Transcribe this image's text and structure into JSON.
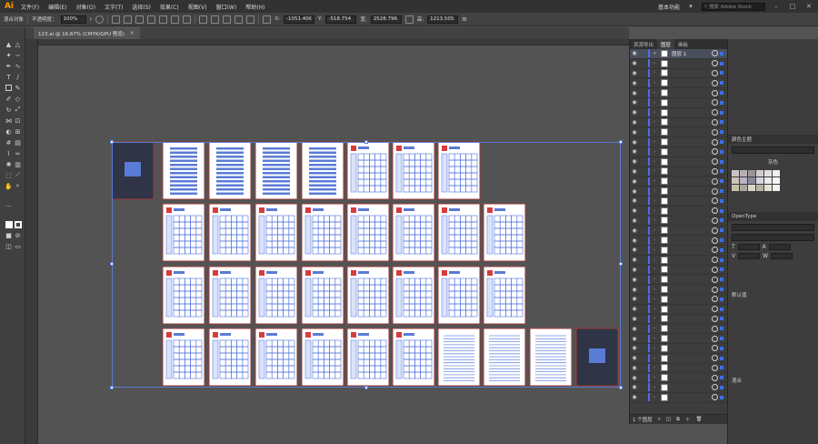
{
  "app": {
    "logo": "Ai"
  },
  "menu": {
    "items": [
      "文件(F)",
      "编辑(E)",
      "对象(O)",
      "文字(T)",
      "选择(S)",
      "效果(C)",
      "视图(V)",
      "窗口(W)",
      "帮助(H)"
    ]
  },
  "workspace": {
    "label": "基本功能",
    "search_placeholder": "搜索 Adobe Stock"
  },
  "controlbar": {
    "selection_label": "混合对象",
    "opacity_label": "不透明度：",
    "opacity_value": "100%",
    "x_label": "X:",
    "x_value": "-1051.40€",
    "y_label": "Y:",
    "y_value": "-518.754",
    "w_label": "宽:",
    "w_value": "2528.796",
    "h_label": "高:",
    "h_value": "1213.505"
  },
  "document": {
    "tab_title": "123.ai @ 16.67% (CMYK/GPU 预览)",
    "close": "×"
  },
  "layers_panel": {
    "tabs": [
      "资源导出",
      "图层",
      "画板"
    ],
    "first_layer_name": "图层 1",
    "footer_count": "1 个图层",
    "row_count": 36
  },
  "right_panels": {
    "color_theme_title": "颜色主题",
    "gray_label": "灰色",
    "opentype_title": "OpenType",
    "default_label": "默认值",
    "mix_label": "混合"
  },
  "colors": {
    "accent": "#4b6fdc",
    "artboard_border": "#9b3b38",
    "selection": "#5a7bd6"
  }
}
